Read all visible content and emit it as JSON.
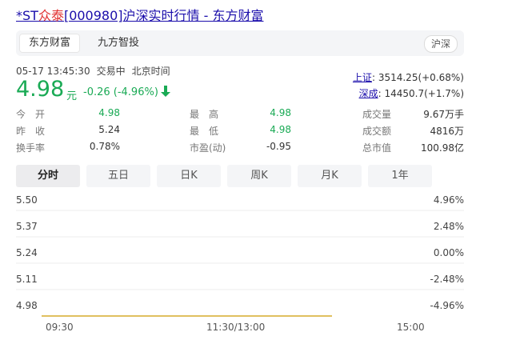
{
  "page": {
    "title_prefix": "*ST",
    "title_highlight": "众泰",
    "title_suffix": "[000980]沪深实时行情 - 东方财富"
  },
  "source_tabs": [
    {
      "label": "东方财富",
      "active": true
    },
    {
      "label": "九方智投",
      "active": false
    }
  ],
  "market_badge": "沪深",
  "status": {
    "datetime": "05-17 13:45:30",
    "state": "交易中",
    "timezone": "北京时间"
  },
  "quote": {
    "price": "4.98",
    "unit": "元",
    "change": "-0.26 (-4.96%)",
    "direction": "down",
    "color": "#1aaa55"
  },
  "indices": [
    {
      "name": "上证",
      "value": ": 3514.25(+0.68%)"
    },
    {
      "name": "深成",
      "value": ": 14450.7(+1.7%)"
    }
  ],
  "stats": [
    {
      "label": "今　开",
      "value": "4.98",
      "color": "green"
    },
    {
      "label": "最　高",
      "value": "4.98",
      "color": "green"
    },
    {
      "label": "成交量",
      "value": "9.67万手",
      "color": "default"
    },
    {
      "label": "昨　收",
      "value": "5.24",
      "color": "default"
    },
    {
      "label": "最　低",
      "value": "4.98",
      "color": "green"
    },
    {
      "label": "成交额",
      "value": "4816万",
      "color": "default"
    },
    {
      "label": "换手率",
      "value": "0.78%",
      "color": "default"
    },
    {
      "label": "市盈(动)",
      "value": "-0.95",
      "color": "default"
    },
    {
      "label": "总市值",
      "value": "100.98亿",
      "color": "default"
    }
  ],
  "period_tabs": [
    {
      "label": "分时",
      "active": true
    },
    {
      "label": "五日",
      "active": false
    },
    {
      "label": "日K",
      "active": false
    },
    {
      "label": "周K",
      "active": false
    },
    {
      "label": "月K",
      "active": false
    },
    {
      "label": "1年",
      "active": false
    }
  ],
  "chart_data": {
    "type": "line",
    "y_ticks": [
      "5.50",
      "5.37",
      "5.24",
      "5.11",
      "4.98"
    ],
    "y_right_ticks": [
      "4.96%",
      "2.48%",
      "0.00%",
      "-2.48%",
      "-4.96%"
    ],
    "x_ticks": [
      "09:30",
      "11:30/13:00",
      "15:00"
    ],
    "ylim": [
      4.98,
      5.5
    ],
    "x": [
      0,
      165
    ],
    "x_total": 240,
    "values": [
      4.98,
      4.98
    ],
    "line_color": "#e0c060",
    "grid": true
  }
}
